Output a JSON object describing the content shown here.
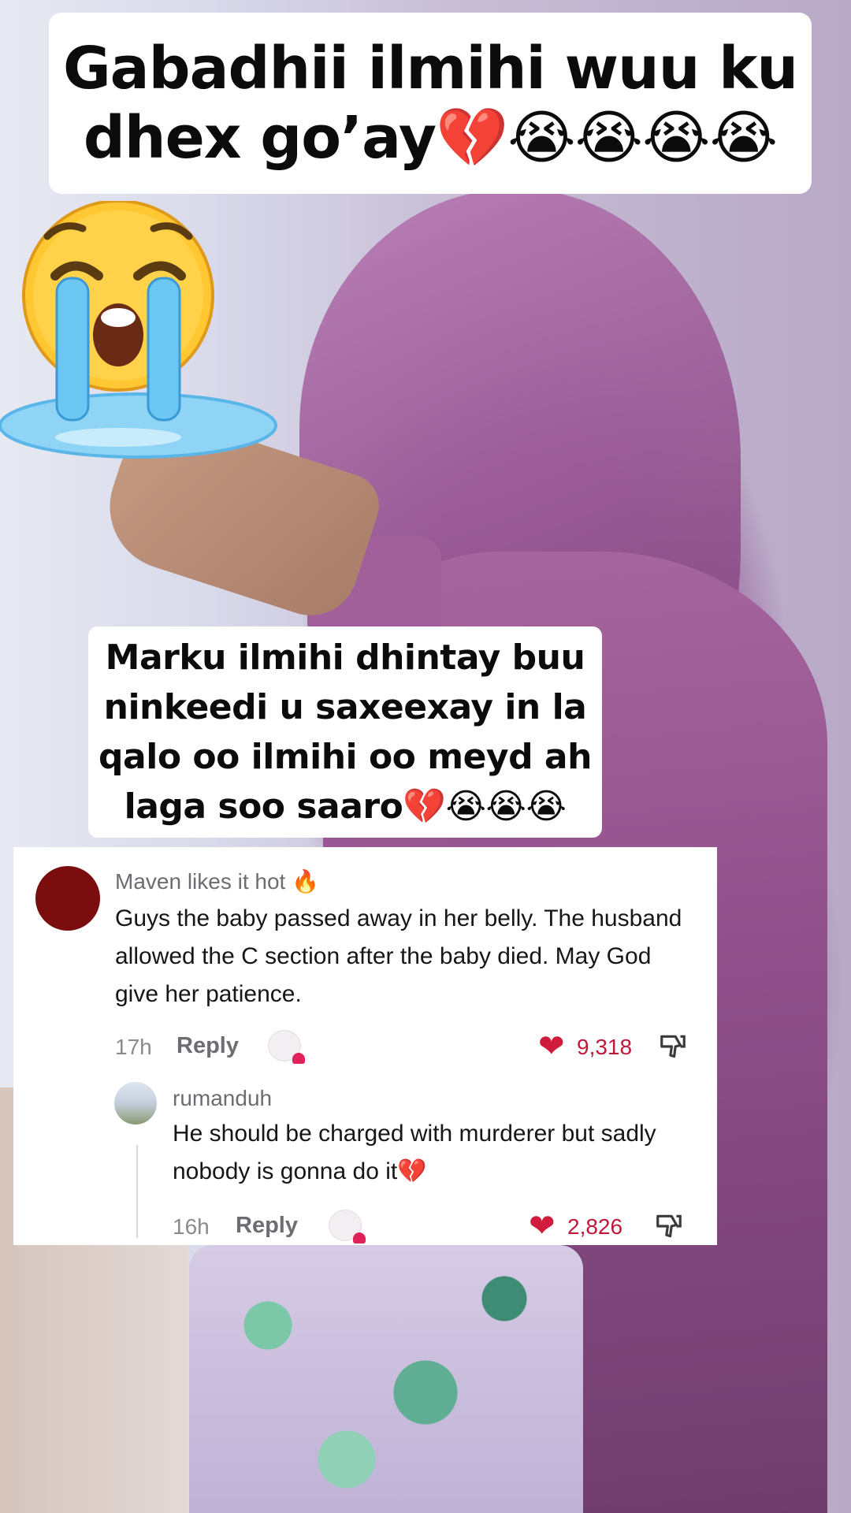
{
  "title": {
    "text": "Gabadhii ilmihi wuu ku dhex go’ay💔😭😭😭😭"
  },
  "caption": {
    "text": "Marku ilmihi dhintay buu ninkeedi u saxeexay in la qalo oo ilmihi oo meyd ah laga soo saaro💔😭😭😭"
  },
  "comments": [
    {
      "user": "Maven likes it hot 🔥",
      "text": "Guys the baby passed away in her belly. The husband allowed the C section after the baby died. May God give her patience.",
      "time": "17h",
      "reply_label": "Reply",
      "likes": "9,318",
      "avatar_color": "#7a0d0d",
      "icons": [
        "sticker-icon",
        "heart-icon",
        "dislike-icon"
      ]
    },
    {
      "user": "rumanduh",
      "text": "He should be charged with murderer but sadly nobody is gonna do it💔",
      "time": "16h",
      "reply_label": "Reply",
      "likes": "2,826",
      "icons": [
        "sticker-icon",
        "heart-icon",
        "dislike-icon"
      ]
    }
  ],
  "colors": {
    "like_red": "#cf1b3c",
    "hijab_purple": "#9b5c97",
    "card_white": "#ffffff"
  }
}
